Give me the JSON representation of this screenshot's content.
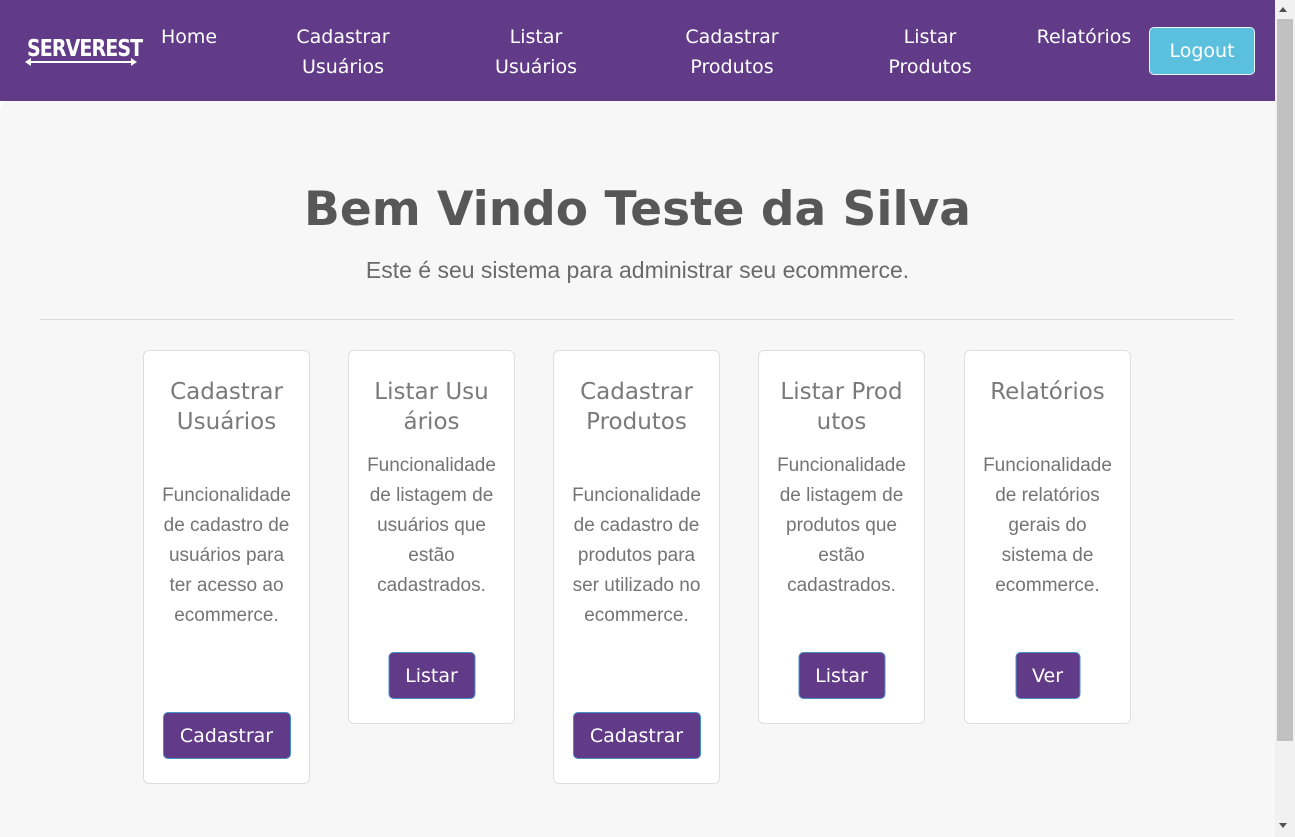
{
  "header": {
    "logo_text": "SERVEREST",
    "nav": [
      {
        "label": "Home"
      },
      {
        "label": "Cadastrar Usuários",
        "line1": "Cadastrar",
        "line2": "Usuários"
      },
      {
        "label": "Listar Usuários",
        "line1": "Listar",
        "line2": "Usuários"
      },
      {
        "label": "Cadastrar Produtos",
        "line1": "Cadastrar",
        "line2": "Produtos"
      },
      {
        "label": "Listar Produtos",
        "line1": "Listar",
        "line2": "Produtos"
      },
      {
        "label": "Relatórios"
      }
    ],
    "logout_label": "Logout"
  },
  "hero": {
    "title": "Bem Vindo Teste da Silva",
    "subtitle": "Este é seu sistema para administrar seu ecommerce."
  },
  "cards": [
    {
      "title": "Cadastrar Usuários",
      "text": "Funcionalidade de cadastro de usuários para ter acesso ao ecommerce.",
      "button": "Cadastrar"
    },
    {
      "title": "Listar Usuários",
      "text": "Funcionalidade de listagem de usuários que estão cadastrados.",
      "button": "Listar"
    },
    {
      "title": "Cadastrar Produtos",
      "text": "Funcionalidade de cadastro de produtos para ser utilizado no ecommerce.",
      "button": "Cadastrar"
    },
    {
      "title": "Listar Produtos",
      "text": "Funcionalidade de listagem de produtos que estão cadastrados.",
      "button": "Listar"
    },
    {
      "title": "Relatórios",
      "text": "Funcionalidade de relatórios gerais do sistema de ecommerce.",
      "button": "Ver"
    }
  ],
  "colors": {
    "primary": "#613b88",
    "logout": "#5bc0de",
    "background": "#f7f7f8"
  }
}
